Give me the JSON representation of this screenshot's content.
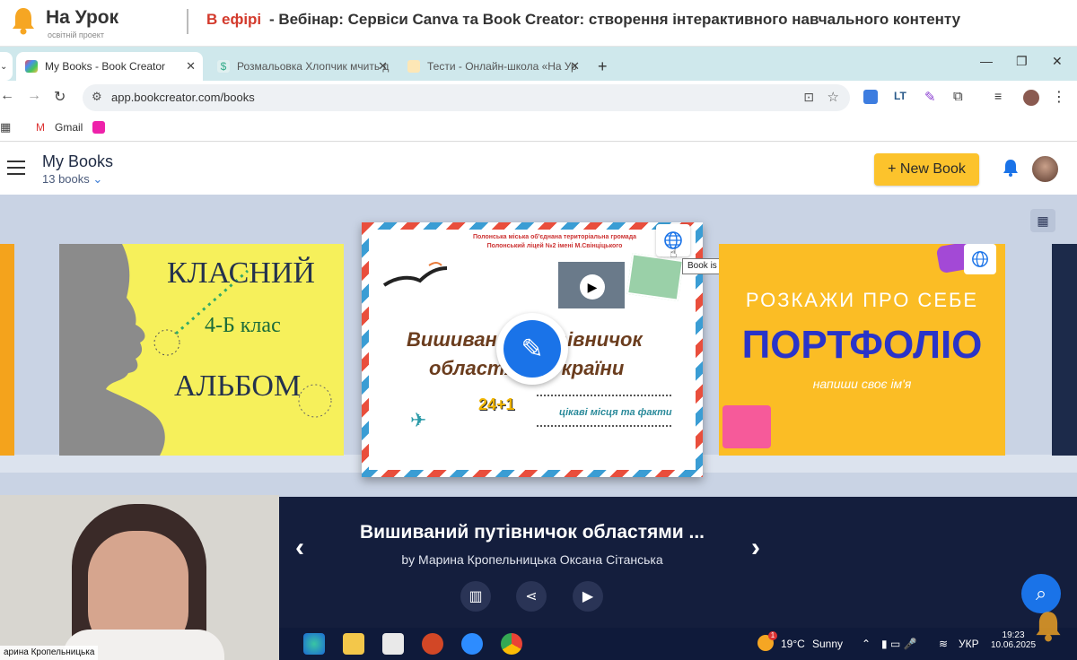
{
  "banner": {
    "brand": "На Урок",
    "brand_sub": "освітній проект",
    "on_air": "В ефірі",
    "webinar_title": " - Вебінар: Сервіси Canva та Book Creator: створення інтерактивного навчального контенту"
  },
  "browser": {
    "tabs": [
      {
        "label": "My Books - Book Creator",
        "close": "✕"
      },
      {
        "label": "Розмальовка Хлопчик мчить д",
        "close": "✕"
      },
      {
        "label": "Тести - Онлайн-школа «На Ур",
        "close": "✕"
      }
    ],
    "new_tab": "+",
    "url": "app.bookcreator.com/books",
    "bookmarks": [
      {
        "label": "Gmail"
      }
    ],
    "window_controls": {
      "minimize": "—",
      "maximize": "❐",
      "close": "✕"
    }
  },
  "app": {
    "title": "My Books",
    "book_count": "13 books",
    "new_book_label": "+ New Book",
    "tooltip": "Book is published, click for options"
  },
  "books": {
    "yellow": {
      "line1": "КЛАСНИЙ",
      "line2": "4-Б клас",
      "line3": "АЛЬБОМ"
    },
    "card": {
      "org1": "Полонська міська об'єднана територіальна громада",
      "org2": "Полонський ліцей №2 імені М.Свінціцького",
      "title1": "Вишиваний путівничок",
      "title2": "областями України",
      "subtitle": "цікаві місця та факти",
      "badge": "24+1"
    },
    "portfolio": {
      "line1": "РОЗКАЖИ ПРО СЕБЕ",
      "line2": "ПОРТФОЛІО",
      "line3": "напиши своє ім'я"
    }
  },
  "selected_book": {
    "title": "Вишиваний путівничок областями ...",
    "author": "by Марина Кропельницька Оксана Сітанська"
  },
  "webcam": {
    "name": "арина Кропельницька"
  },
  "taskbar": {
    "weather_temp": "19°C",
    "weather_text": "Sunny",
    "lang": "УКР",
    "time": "19:23",
    "date": "10.06.2025",
    "weather_badge": "1"
  },
  "colors": {
    "accent": "#fcc32c",
    "primary": "#1a73e8",
    "shelf": "#c9d3e4",
    "infobar": "#141e3d"
  }
}
